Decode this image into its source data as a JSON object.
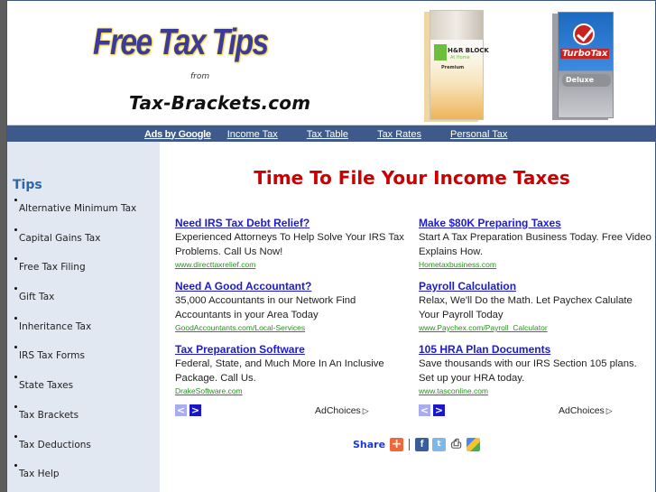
{
  "header": {
    "logo_title": "Free Tax Tips",
    "logo_from": "from",
    "logo_site": "Tax-Brackets.com",
    "products": [
      {
        "name": "H&R BLOCK",
        "subtitle": "At Home",
        "edition": "Premium"
      },
      {
        "name": "TurboTax",
        "edition": "Deluxe"
      }
    ]
  },
  "navbar": {
    "ads_label": "Ads by Google",
    "links": [
      "Income Tax",
      "Tax Table",
      "Tax Rates",
      "Personal Tax"
    ]
  },
  "sidebar": {
    "heading": "Tips",
    "items": [
      "Alternative Minimum Tax",
      "Capital Gains Tax",
      "Free Tax Filing",
      "Gift Tax",
      "Inheritance Tax",
      "IRS Tax Forms",
      "State Taxes",
      "Tax Brackets",
      "Tax Deductions",
      "Tax Help"
    ]
  },
  "main": {
    "title": "Time To File Your Income Taxes",
    "ads_left": [
      {
        "title": "Need IRS Tax Debt Relief?",
        "text": "Experienced Attorneys To Help Solve Your IRS Tax Problems. Call Us Now!",
        "url": "www.directtaxrelief.com"
      },
      {
        "title": "Need A Good Accountant?",
        "text": "35,000 Accountants in our Network Find Accountants in your Area Today",
        "url": "GoodAccountants.com/Local-Services"
      },
      {
        "title": "Tax Preparation Software",
        "text": "Federal, State, and Much More In An Inclusive Package. Call Us.",
        "url": "DrakeSoftware.com"
      }
    ],
    "ads_right": [
      {
        "title": "Make $80K Preparing Taxes",
        "text": "Start A Tax Preparation Business Today. Free Video Explains How.",
        "url": "Hometaxbusiness.com"
      },
      {
        "title": "Payroll Calculation",
        "text": "Relax, We'll Do the Math. Let Paychex Calulate Your Payroll Today",
        "url": "www.Paychex.com/Payroll_Calculator"
      },
      {
        "title": "105 HRA Plan Documents",
        "text": "Save thousands with our IRS Section 105 plans. Set up your HRA today.",
        "url": "www.tasconline.com"
      }
    ],
    "ad_footer": {
      "prev": "<",
      "next": ">",
      "adchoices": "AdChoices",
      "adchoices_icon": "▷"
    },
    "share": {
      "label": "Share",
      "plus": "+",
      "facebook": "f",
      "twitter": "t",
      "print": "⎙",
      "google": ""
    }
  }
}
